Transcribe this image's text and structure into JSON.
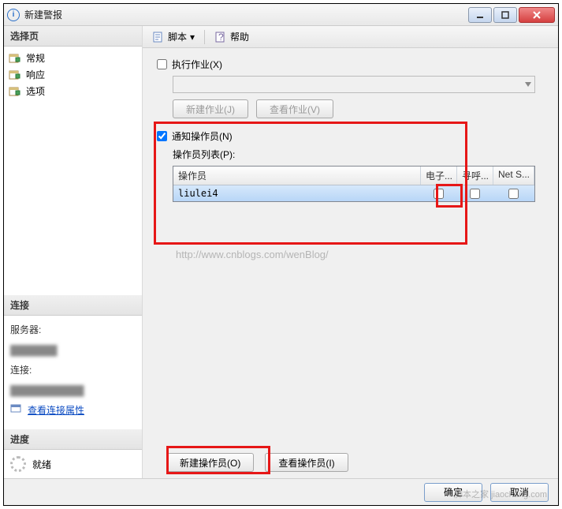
{
  "window": {
    "title": "新建警报"
  },
  "sidebar": {
    "select_page": "选择页",
    "items": [
      {
        "label": "常规"
      },
      {
        "label": "响应"
      },
      {
        "label": "选项"
      }
    ],
    "connection_header": "连接",
    "server_label": "服务器:",
    "conn_label": "连接:",
    "view_props": "查看连接属性",
    "progress_header": "进度",
    "ready": "就绪"
  },
  "toolbar": {
    "script": "脚本",
    "help": "帮助"
  },
  "content": {
    "exec_job": "执行作业(X)",
    "new_job": "新建作业(J)",
    "view_job": "查看作业(V)",
    "notify_operator": "通知操作员(N)",
    "operator_list": "操作员列表(P):",
    "columns": {
      "operator": "操作员",
      "email": "电子...",
      "pager": "寻呼...",
      "netsend": "Net S..."
    },
    "rows": [
      {
        "name": "liulei4",
        "email": false,
        "pager": false,
        "netsend": false
      }
    ],
    "new_operator": "新建操作员(O)",
    "view_operator": "查看操作员(I)"
  },
  "footer": {
    "ok": "确定",
    "cancel": "取消"
  },
  "watermark": "http://www.cnblogs.com/wenBlog/",
  "watermark2": "脚本之家 jiaochang.com"
}
